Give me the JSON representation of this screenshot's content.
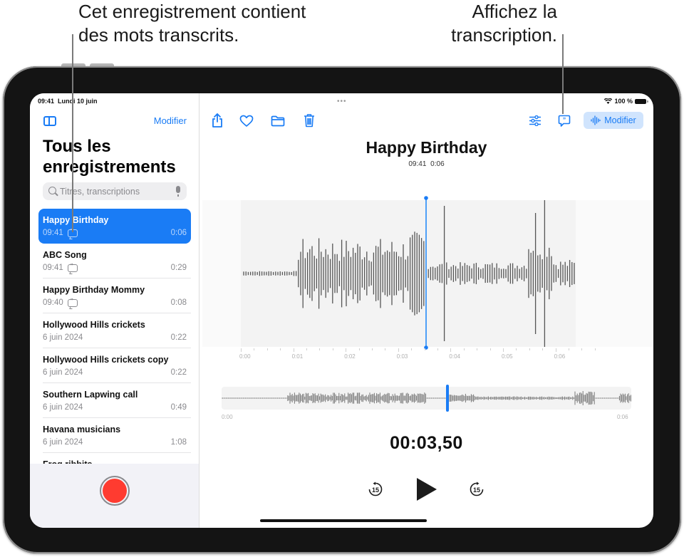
{
  "callouts": {
    "left_line1": "Cet enregistrement contient",
    "left_line2": "des mots transcrits.",
    "right_line1": "Affichez la",
    "right_line2": "transcription."
  },
  "status_bar": {
    "time": "09:41",
    "date": "Lundi 10 juin",
    "battery": "100 %"
  },
  "sidebar": {
    "edit_label": "Modifier",
    "title_line1": "Tous les",
    "title_line2": "enregistrements",
    "search_placeholder": "Titres, transcriptions",
    "recordings": [
      {
        "name": "Happy Birthday",
        "time": "09:41",
        "transcribed": true,
        "duration": "0:06",
        "selected": true
      },
      {
        "name": "ABC Song",
        "time": "09:41",
        "transcribed": true,
        "duration": "0:29",
        "selected": false
      },
      {
        "name": "Happy Birthday Mommy",
        "time": "09:40",
        "transcribed": true,
        "duration": "0:08",
        "selected": false
      },
      {
        "name": "Hollywood Hills crickets",
        "time": "6 juin 2024",
        "transcribed": false,
        "duration": "0:22",
        "selected": false
      },
      {
        "name": "Hollywood Hills crickets copy",
        "time": "6 juin 2024",
        "transcribed": false,
        "duration": "0:22",
        "selected": false
      },
      {
        "name": "Southern Lapwing call",
        "time": "6 juin 2024",
        "transcribed": false,
        "duration": "0:49",
        "selected": false
      },
      {
        "name": "Havana musicians",
        "time": "6 juin 2024",
        "transcribed": false,
        "duration": "1:08",
        "selected": false
      },
      {
        "name": "Frog ribbits",
        "time": "",
        "transcribed": false,
        "duration": "",
        "selected": false
      }
    ]
  },
  "toolbar": {
    "grabber": "•••",
    "icons": [
      "share-icon",
      "heart-icon",
      "folder-icon",
      "trash-icon"
    ],
    "right_icons": [
      "options-icon",
      "transcript-icon"
    ],
    "edit_label": "Modifier"
  },
  "recording": {
    "title": "Happy Birthday",
    "time": "09:41",
    "duration": "0:06",
    "timer": "00:03,50",
    "playhead_seconds": 3.5,
    "total_seconds": 6.3,
    "timeline_ticks": [
      "0:00",
      "0:01",
      "0:02",
      "0:03",
      "0:04",
      "0:05",
      "0:06"
    ],
    "overview_start": "0:00",
    "overview_end": "0:06",
    "skip_back": "15",
    "skip_forward": "15"
  },
  "colors": {
    "accent": "#1a7cf5",
    "record": "#ff3b30",
    "selected_row": "#1a7cf5"
  }
}
